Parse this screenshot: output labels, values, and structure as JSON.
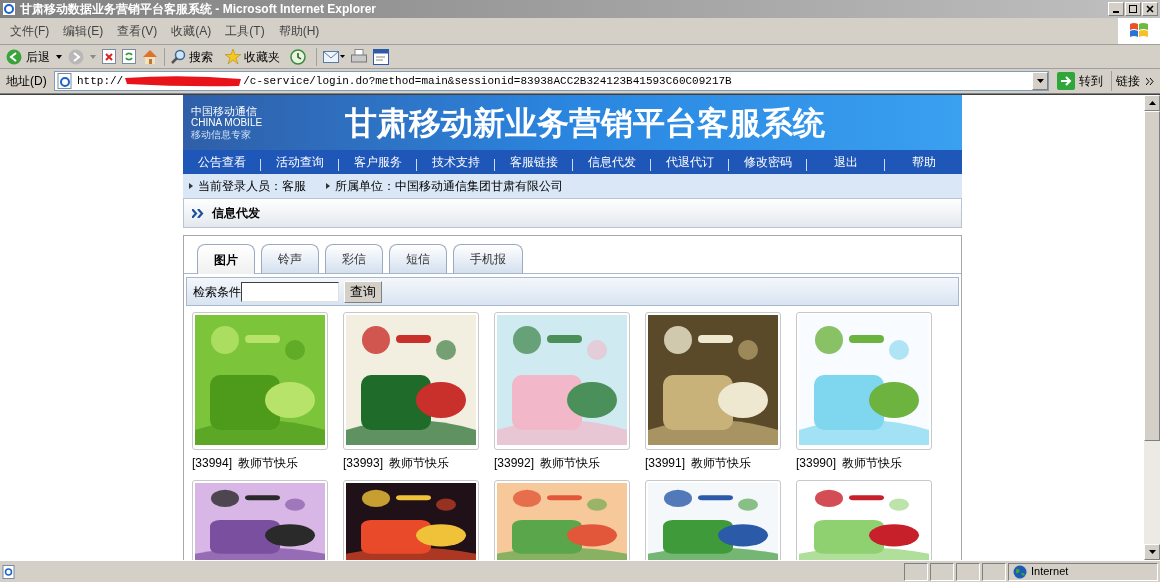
{
  "window": {
    "title": "甘肃移动数据业务营销平台客服系统 - Microsoft Internet Explorer"
  },
  "menu": [
    "文件(F)",
    "编辑(E)",
    "查看(V)",
    "收藏(A)",
    "工具(T)",
    "帮助(H)"
  ],
  "toolbar": {
    "back": "后退",
    "search": "搜索",
    "favorites": "收藏夹"
  },
  "address_bar": {
    "label": "地址(D)",
    "url_start": "http://",
    "url_end": "/c-service/login.do?method=main&sessionid=83938ACC2B324123B41593C60C09217B",
    "go": "转到",
    "links": "链接"
  },
  "page": {
    "logo": {
      "name_cn": "中国移动通信",
      "name_en": "CHINA MOBILE",
      "slogan": "移动信息专家"
    },
    "banner_title": "甘肃移动新业务营销平台客服系统",
    "nav": [
      "公告查看",
      "活动查询",
      "客户服务",
      "技术支持",
      "客服链接",
      "信息代发",
      "代退代订",
      "修改密码",
      "退出",
      "帮助"
    ],
    "info": [
      "当前登录人员：客服",
      "所属单位：中国移动通信集团甘肃有限公司"
    ],
    "section_title": "信息代发",
    "tabs": [
      {
        "label": "图片",
        "selected": true
      },
      {
        "label": "铃声",
        "selected": false
      },
      {
        "label": "彩信",
        "selected": false
      },
      {
        "label": "短信",
        "selected": false
      },
      {
        "label": "手机报",
        "selected": false
      }
    ],
    "search": {
      "label": "检索条件",
      "button": "查询"
    },
    "gallery": [
      [
        {
          "kind": "picture",
          "id": "[33994]",
          "caption": "教师节快乐"
        },
        {
          "kind": "picture",
          "id": "[33993]",
          "caption": "教师节快乐"
        },
        {
          "kind": "picture",
          "id": "[33992]",
          "caption": "教师节快乐"
        },
        {
          "kind": "picture",
          "id": "[33991]",
          "caption": "教师节快乐"
        },
        {
          "kind": "picture",
          "id": "[33990]",
          "caption": "教师节快乐"
        }
      ],
      [
        {
          "kind": "picture"
        },
        {
          "kind": "picture"
        },
        {
          "kind": "picture"
        },
        {
          "kind": "picture"
        },
        {
          "kind": "picture"
        }
      ]
    ]
  },
  "status_bar": {
    "zone": "Internet"
  }
}
